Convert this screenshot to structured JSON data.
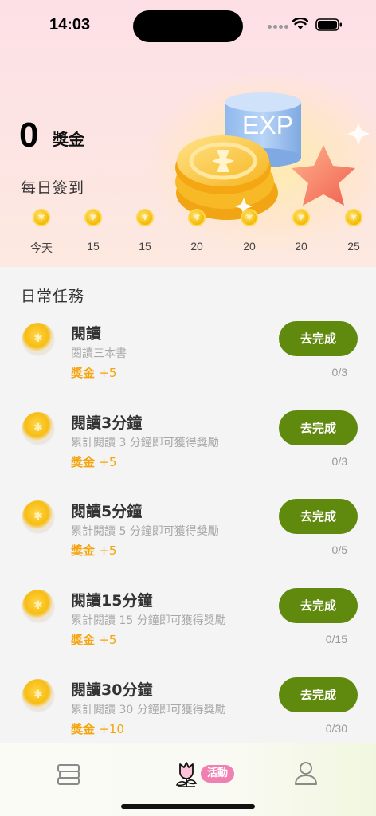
{
  "status_bar": {
    "time": "14:03"
  },
  "hero": {
    "balance": "0",
    "balance_label": "獎金",
    "illustration_text": "EXP",
    "checkin_title": "每日簽到",
    "days": [
      {
        "label": "今天"
      },
      {
        "label": "15"
      },
      {
        "label": "15"
      },
      {
        "label": "20"
      },
      {
        "label": "20"
      },
      {
        "label": "20"
      },
      {
        "label": "25"
      }
    ]
  },
  "tasks_section": {
    "title": "日常任務",
    "tasks": [
      {
        "title": "閱讀",
        "desc": "閱讀三本書",
        "reward_label": "獎金",
        "reward_amount": "+5",
        "button": "去完成",
        "progress": "0/3"
      },
      {
        "title": "閱讀3分鐘",
        "desc": "累計閱讀 3 分鐘即可獲得獎勵",
        "reward_label": "獎金",
        "reward_amount": "+5",
        "button": "去完成",
        "progress": "0/3"
      },
      {
        "title": "閱讀5分鐘",
        "desc": "累計閱讀 5 分鐘即可獲得獎勵",
        "reward_label": "獎金",
        "reward_amount": "+5",
        "button": "去完成",
        "progress": "0/5"
      },
      {
        "title": "閱讀15分鐘",
        "desc": "累計閱讀 15 分鐘即可獲得獎勵",
        "reward_label": "獎金",
        "reward_amount": "+5",
        "button": "去完成",
        "progress": "0/15"
      },
      {
        "title": "閱讀30分鐘",
        "desc": "累計閱讀 30 分鐘即可獲得獎勵",
        "reward_label": "獎金",
        "reward_amount": "+10",
        "button": "去完成",
        "progress": "0/30"
      }
    ]
  },
  "tabbar": {
    "items": [
      {
        "icon": "bookshelf-icon"
      },
      {
        "icon": "rose-icon",
        "badge": "活動"
      },
      {
        "icon": "user-icon"
      }
    ]
  },
  "colors": {
    "accent_green": "#5f8a0d",
    "reward_orange": "#f5a40b",
    "badge_pink": "#f07fb2"
  }
}
